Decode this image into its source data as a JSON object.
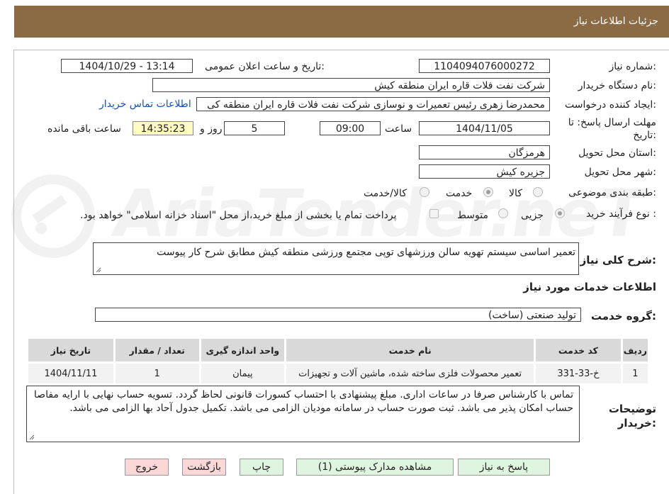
{
  "header": {
    "title": "جزئیات اطلاعات نیاز"
  },
  "fields": {
    "need_number_label": "شماره نیاز:",
    "need_number": "1104094076000272",
    "announce_label": "تاریخ و ساعت اعلان عمومی:",
    "announce_value": "1404/10/29 - 13:14",
    "buyer_org_label": "نام دستگاه خریدار:",
    "buyer_org": "شرکت نفت فلات قاره ایران منطقه کیش",
    "requester_label": "ایجاد کننده درخواست:",
    "requester": "محمدرضا  زهری رئیس تعمیرات و نوسازی  شرکت نفت فلات قاره ایران منطقه کی",
    "contact_link": "اطلاعات تماس خریدار",
    "deadline_label": "مهلت ارسال پاسخ: تا تاریخ:",
    "deadline_date": "1404/11/05",
    "time_label": "ساعت",
    "deadline_time": "09:00",
    "days_value": "5",
    "days_label": "روز و",
    "remaining_time": "14:35:23",
    "remaining_label": "ساعت باقی مانده",
    "province_label": "استان محل تحویل:",
    "province": "هرمزگان",
    "city_label": "شهر محل تحویل:",
    "city": "جزیره کیش"
  },
  "category": {
    "label": "طبقه بندی موضوعی:",
    "options": [
      "کالا",
      "خدمت",
      "کالا/خدمت"
    ],
    "selected": "خدمت"
  },
  "process": {
    "label": "نوع فرآیند خرید :",
    "options": [
      "جزیی",
      "متوسط"
    ],
    "selected": "جزیی",
    "note": "پرداخت تمام یا بخشی از مبلغ خرید،از محل \"اسناد خزانه اسلامی\" خواهد بود."
  },
  "summary": {
    "label": "شرح کلی نیاز:",
    "text": "تعمیر اساسی سیستم تهویه سالن ورزشهای توپی مجتمع ورزشی منطقه کیش مطابق شرح کار پیوست"
  },
  "services_title": "اطلاعات خدمات مورد نیاز",
  "service_group": {
    "label": "گروه خدمت:",
    "value": "تولید صنعتی (ساخت)"
  },
  "table": {
    "headers": [
      "ردیف",
      "کد خدمت",
      "نام خدمت",
      "واحد اندازه گیری",
      "تعداد / مقدار",
      "تاریخ نیاز"
    ],
    "rows": [
      [
        "1",
        "خ-33-331",
        "تعمیر محصولات فلزی ساخته شده، ماشین آلات و تجهیزات",
        "پیمان",
        "1",
        "1404/11/11"
      ]
    ]
  },
  "buyer_notes": {
    "label": "توضیحات خریدار:",
    "text": "تماس با کارشناس صرفا در ساعات اداری. مبلغ پیشنهادی با احتساب کسورات قانونی لحاظ گردد. تسویه حساب نهایی با ارایه مفاصا حساب امکان پذیر می باشد. ثبت صورت حساب در سامانه مودیان الزامی می باشد. تکمیل جدول آحاد بها الزامی می باشد."
  },
  "buttons": {
    "reply": "پاسخ به نیاز",
    "attachments": "مشاهده مدارک پیوستی (1)",
    "print": "چاپ",
    "back": "بازگشت",
    "exit": "خروج"
  },
  "watermark": "AriaTender.neT",
  "colors": {
    "header_bg": "#8b6b43",
    "link": "#1a4fb8",
    "remaining_bg": "#fff9c4",
    "green_btn": "#dff5df",
    "pink_btn": "#fbd8d8"
  }
}
